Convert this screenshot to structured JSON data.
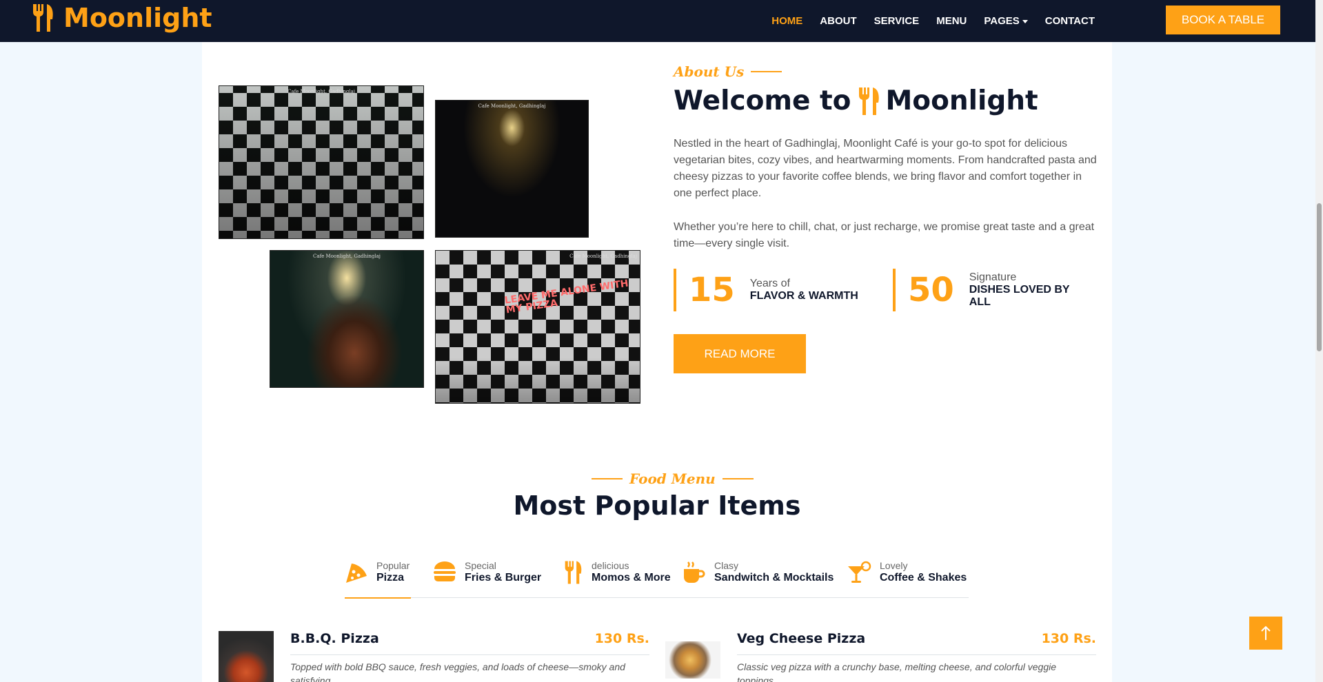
{
  "brand": {
    "name": "Moonlight",
    "icon": "utensils-icon",
    "color": "#fea116"
  },
  "nav": {
    "items": [
      {
        "label": "HOME",
        "active": true
      },
      {
        "label": "ABOUT"
      },
      {
        "label": "SERVICE"
      },
      {
        "label": "MENU"
      },
      {
        "label": "PAGES"
      },
      {
        "label": "CONTACT"
      }
    ],
    "cta": "BOOK A TABLE"
  },
  "photos": {
    "caption": "Cafe Moonlight, Gadhinglaj",
    "mural_text": "LEAVE ME ALONE WITH MY PIZZA"
  },
  "about": {
    "subtitle": "About Us",
    "title_prefix": "Welcome to",
    "title_brand": "Moonlight",
    "paragraph1": "Nestled in the heart of Gadhinglaj, Moonlight Café is your go-to spot for delicious vegetarian bites, cozy vibes, and heartwarming moments. From handcrafted pasta and cheesy pizzas to your favorite coffee blends, we bring flavor and comfort together in one perfect place.",
    "paragraph2": "Whether you’re here to chill, chat, or just recharge, we promise great taste and a great time—every single visit.",
    "stats": [
      {
        "number": "15",
        "small": "Years of",
        "big": "FLAVOR & WARMTH"
      },
      {
        "number": "50",
        "small": "Signature",
        "big": "DISHES LOVED BY ALL"
      }
    ],
    "button": "READ MORE"
  },
  "menu": {
    "subtitle": "Food Menu",
    "title": "Most Popular Items",
    "tabs": [
      {
        "small": "Popular",
        "big": "Pizza",
        "icon": "pizza-icon",
        "active": true
      },
      {
        "small": "Special",
        "big": "Fries & Burger",
        "icon": "burger-icon"
      },
      {
        "small": "delicious",
        "big": "Momos & More",
        "icon": "utensils-icon"
      },
      {
        "small": "Clasy",
        "big": "Sandwitch & Mocktails",
        "icon": "coffee-cup-icon"
      },
      {
        "small": "Lovely",
        "big": "Coffee & Shakes",
        "icon": "cocktail-icon"
      }
    ],
    "items": [
      {
        "name": "B.B.Q. Pizza",
        "price": "130 Rs.",
        "desc": "Topped with bold BBQ sauce, fresh veggies, and loads of cheese—smoky and satisfying."
      },
      {
        "name": "Veg Cheese Pizza",
        "price": "130 Rs.",
        "desc": "Classic veg pizza with a crunchy base, melting cheese, and colorful veggie toppings."
      }
    ]
  },
  "back_to_top": "arrow-up-icon"
}
